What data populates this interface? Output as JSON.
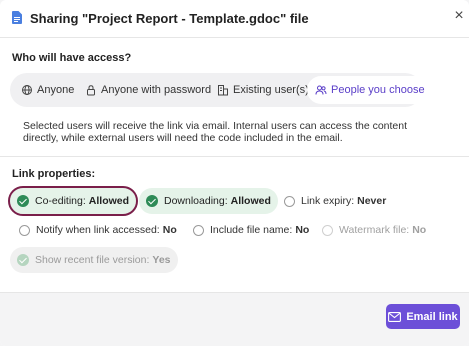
{
  "dialog": {
    "title": "Sharing \"Project Report - Template.gdoc\" file",
    "close_glyph": "×"
  },
  "access": {
    "heading": "Who will have access?",
    "options": [
      {
        "label": "Anyone",
        "icon": "globe-icon"
      },
      {
        "label": "Anyone with password",
        "icon": "lock-icon"
      },
      {
        "label": "Existing user(s)",
        "icon": "building-icon"
      },
      {
        "label": "People you choose",
        "icon": "people-icon",
        "selected": true
      }
    ],
    "description": "Selected users will receive the link via email. Internal users can access the content directly, while external users will need the code included in the email."
  },
  "properties": {
    "heading": "Link properties:",
    "items": [
      {
        "label": "Co-editing:",
        "value": "Allowed",
        "state": "on",
        "highlighted": true
      },
      {
        "label": "Downloading:",
        "value": "Allowed",
        "state": "on"
      },
      {
        "label": "Link expiry:",
        "value": "Never",
        "state": "off"
      },
      {
        "label": "Notify when link accessed:",
        "value": "No",
        "state": "off"
      },
      {
        "label": "Include file name:",
        "value": "No",
        "state": "off"
      },
      {
        "label": "Watermark file:",
        "value": "No",
        "state": "disabled"
      },
      {
        "label": "Show recent file version:",
        "value": "Yes",
        "state": "disabled-on"
      }
    ]
  },
  "footer": {
    "email_label": "Email link",
    "email_icon": "envelope-icon"
  },
  "colors": {
    "accent": "#6c4fd8",
    "success": "#2e8b57",
    "highlight_outline": "#7a1f4a"
  }
}
